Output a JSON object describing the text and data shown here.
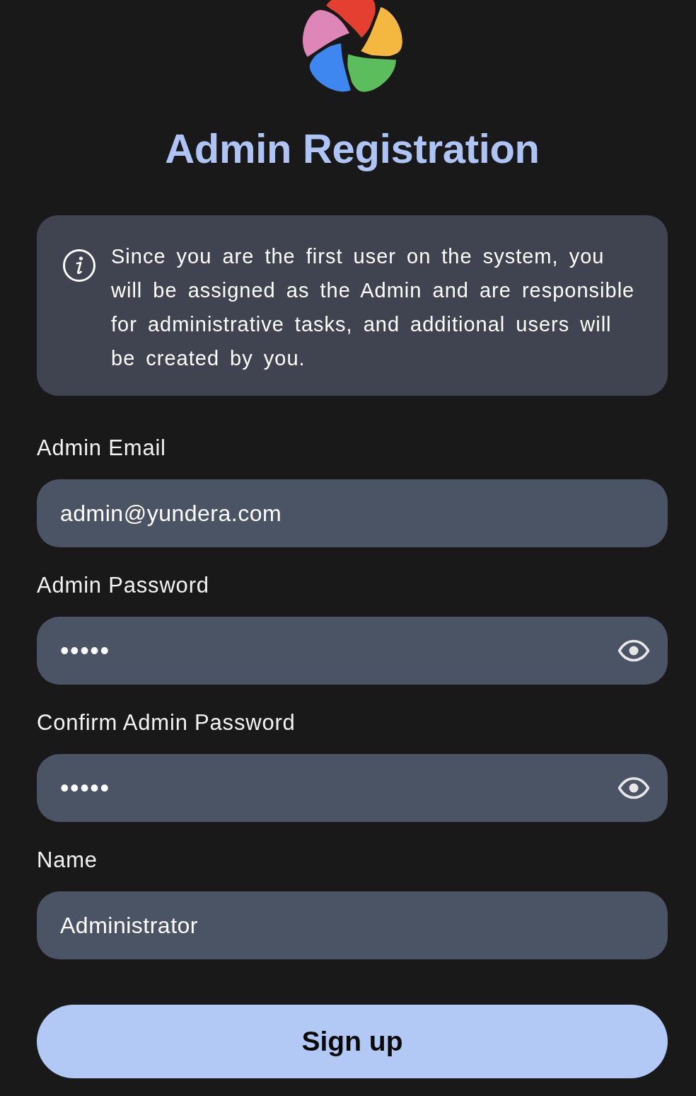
{
  "title": "Admin Registration",
  "notice": {
    "text": "Since you are the first user on the system, you will be assigned as the Admin and are responsible for administrative tasks, and additional users will be created by you."
  },
  "fields": [
    {
      "kind": "text",
      "label": "Admin Email",
      "value": "admin@yundera.com"
    },
    {
      "kind": "password",
      "label": "Admin Password",
      "value": "•••••"
    },
    {
      "kind": "password",
      "label": "Confirm Admin Password",
      "value": "•••••"
    },
    {
      "kind": "text",
      "label": "Name",
      "value": "Administrator"
    }
  ],
  "submit_button": {
    "label": "Sign up"
  }
}
